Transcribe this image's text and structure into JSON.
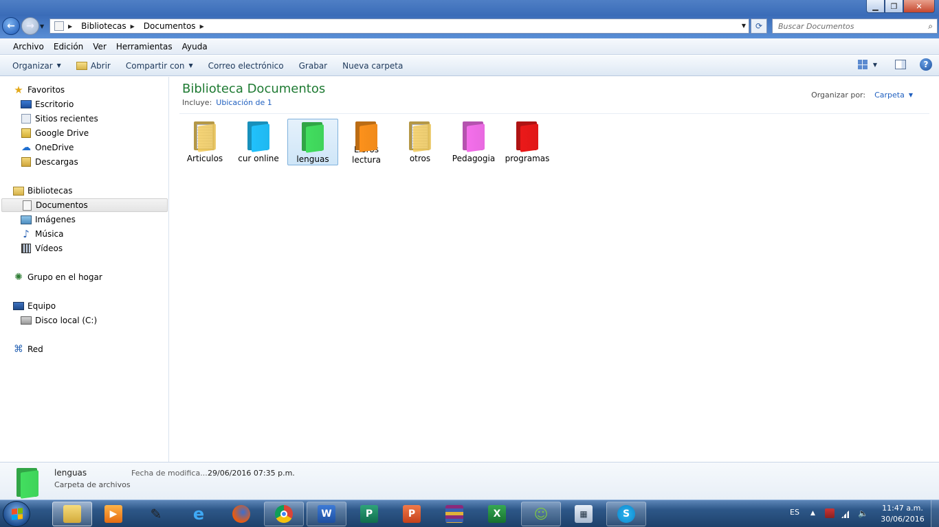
{
  "window": {
    "minimize_glyph": "▁",
    "maximize_glyph": "❐",
    "close_glyph": "✕"
  },
  "address": {
    "crumbs": [
      "Bibliotecas",
      "Documentos"
    ],
    "search_placeholder": "Buscar Documentos"
  },
  "menu": {
    "items": [
      "Archivo",
      "Edición",
      "Ver",
      "Herramientas",
      "Ayuda"
    ]
  },
  "toolbar": {
    "organize": "Organizar",
    "open": "Abrir",
    "share": "Compartir con",
    "email": "Correo electrónico",
    "burn": "Grabar",
    "new_folder": "Nueva carpeta"
  },
  "sidebar": {
    "favorites": "Favoritos",
    "favorites_items": [
      "Escritorio",
      "Sitios recientes",
      "Google Drive",
      "OneDrive",
      "Descargas"
    ],
    "libraries": "Bibliotecas",
    "libraries_items": [
      "Documentos",
      "Imágenes",
      "Música",
      "Vídeos"
    ],
    "homegroup": "Grupo en el hogar",
    "computer": "Equipo",
    "computer_items": [
      "Disco local (C:)"
    ],
    "network": "Red"
  },
  "library": {
    "title": "Biblioteca Documentos",
    "includes_label": "Incluye:",
    "includes_link": "Ubicación de 1",
    "arrange_label": "Organizar por:",
    "arrange_value": "Carpeta"
  },
  "folders": [
    {
      "name": "Articulos",
      "color": "#e8c35a",
      "kind": "papers"
    },
    {
      "name": "cur online",
      "color": "#1fb8f0",
      "kind": "plain"
    },
    {
      "name": "lenguas",
      "color": "#3fd35a",
      "kind": "plain"
    },
    {
      "name": "Libros lectura",
      "color": "#f08a1a",
      "kind": "plain"
    },
    {
      "name": "otros",
      "color": "#e8c35a",
      "kind": "papers"
    },
    {
      "name": "Pedagogia",
      "color": "#e86ae0",
      "kind": "plain"
    },
    {
      "name": "programas",
      "color": "#e01818",
      "kind": "plain"
    }
  ],
  "details": {
    "name": "lenguas",
    "type": "Carpeta de archivos",
    "modified_label": "Fecha de modifica...",
    "modified_value": "29/06/2016 07:35 p.m.",
    "color": "#3fd35a"
  },
  "taskbar": {
    "apps": [
      "explorer",
      "media-player",
      "microphone",
      "internet-explorer",
      "firefox",
      "chrome",
      "word",
      "publisher",
      "powerpoint",
      "winrar",
      "excel",
      "messenger",
      "calculator",
      "skype"
    ],
    "language": "ES",
    "time": "11:47 a.m.",
    "date": "30/06/2016"
  }
}
